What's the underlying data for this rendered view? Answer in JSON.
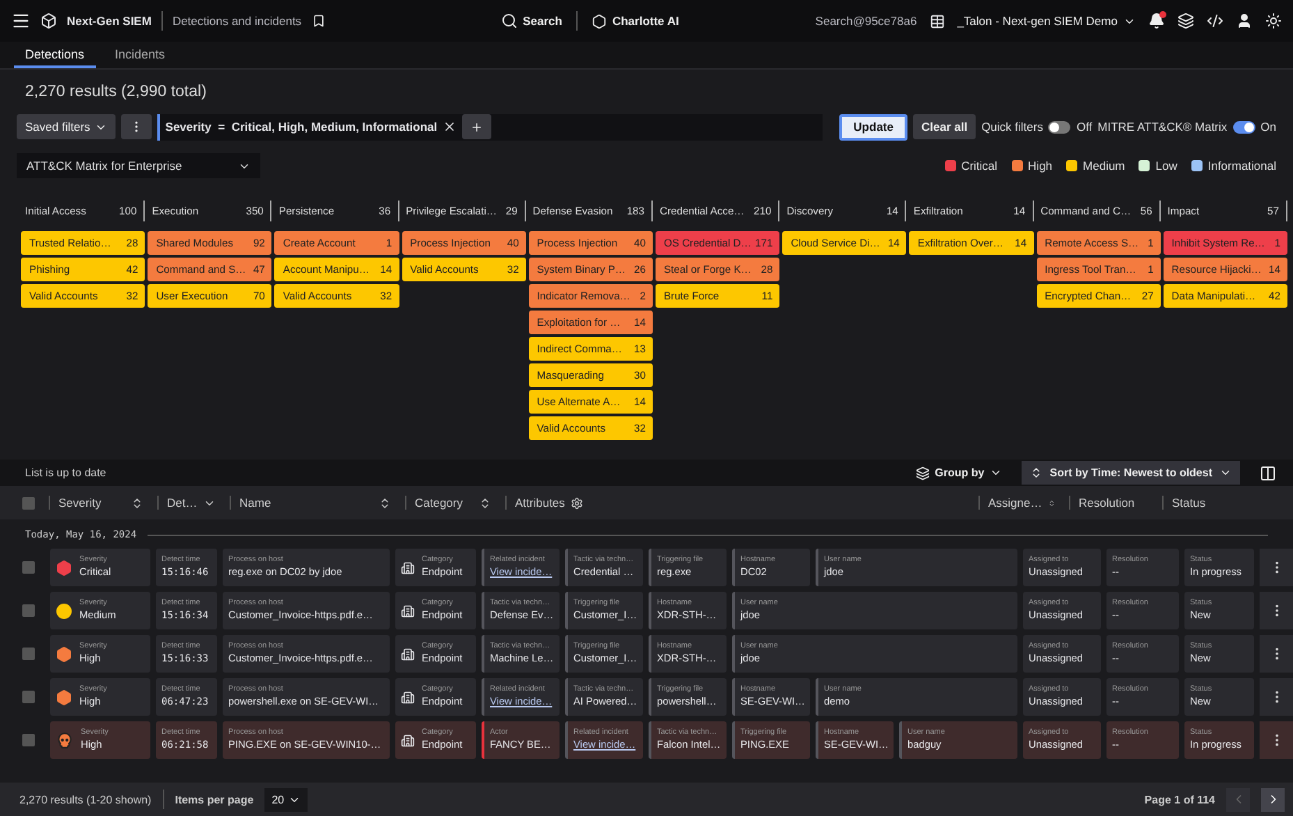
{
  "topbar": {
    "product": "Next-Gen SIEM",
    "page": "Detections and incidents",
    "search": "Search",
    "assistant": "Charlotte AI",
    "search_id": "Search@95ce78a6",
    "tenant": "_Talon - Next-gen SIEM Demo"
  },
  "tabs": [
    {
      "label": "Detections",
      "selected": true
    },
    {
      "label": "Incidents",
      "selected": false
    }
  ],
  "results": "2,270 results (2,990 total)",
  "filters": {
    "saved": "Saved filters",
    "chip_field": "Severity",
    "chip_op": "=",
    "chip_value": "Critical, High, Medium, Informational",
    "update": "Update",
    "clear": "Clear all",
    "toggles": [
      {
        "label": "Quick filters",
        "on": false,
        "state_label": "Off"
      },
      {
        "label": "MITRE ATT&CK® Matrix",
        "on": true,
        "state_label": "On"
      }
    ]
  },
  "matrix_select": "ATT&CK Matrix for Enterprise",
  "legend": [
    {
      "label": "Critical",
      "color": "#ee3f4a"
    },
    {
      "label": "High",
      "color": "#f47b3f"
    },
    {
      "label": "Medium",
      "color": "#fdc700"
    },
    {
      "label": "Low",
      "color": "#d6f2d6"
    },
    {
      "label": "Informational",
      "color": "#9cc3f5"
    }
  ],
  "matrix": [
    {
      "name": "Initial Access",
      "count": "100",
      "tiles": [
        {
          "label": "Trusted Relatio…",
          "count": "28",
          "color": "#fdc700"
        },
        {
          "label": "Phishing",
          "count": "42",
          "color": "#fdc700"
        },
        {
          "label": "Valid Accounts",
          "count": "32",
          "color": "#fdc700"
        }
      ]
    },
    {
      "name": "Execution",
      "count": "350",
      "tiles": [
        {
          "label": "Shared Modules",
          "count": "92",
          "color": "#f47b3f"
        },
        {
          "label": "Command and S…",
          "count": "47",
          "color": "#f47b3f"
        },
        {
          "label": "User Execution",
          "count": "70",
          "color": "#fdc700"
        }
      ]
    },
    {
      "name": "Persistence",
      "count": "36",
      "tiles": [
        {
          "label": "Create Account",
          "count": "1",
          "color": "#f47b3f"
        },
        {
          "label": "Account Manipu…",
          "count": "14",
          "color": "#fdc700"
        },
        {
          "label": "Valid Accounts",
          "count": "32",
          "color": "#fdc700"
        }
      ]
    },
    {
      "name": "Privilege Escalati…",
      "count": "29",
      "tiles": [
        {
          "label": "Process Injection",
          "count": "40",
          "color": "#f47b3f"
        },
        {
          "label": "Valid Accounts",
          "count": "32",
          "color": "#fdc700"
        }
      ]
    },
    {
      "name": "Defense Evasion",
      "count": "183",
      "tiles": [
        {
          "label": "Process Injection",
          "count": "40",
          "color": "#f47b3f"
        },
        {
          "label": "System Binary P…",
          "count": "26",
          "color": "#f47b3f"
        },
        {
          "label": "Indicator Remova…",
          "count": "2",
          "color": "#f47b3f"
        },
        {
          "label": "Exploitation for …",
          "count": "14",
          "color": "#f47b3f"
        },
        {
          "label": "Indirect Comma…",
          "count": "13",
          "color": "#fdc700"
        },
        {
          "label": "Masquerading",
          "count": "30",
          "color": "#fdc700"
        },
        {
          "label": "Use Alternate A…",
          "count": "14",
          "color": "#fdc700"
        },
        {
          "label": "Valid Accounts",
          "count": "32",
          "color": "#fdc700"
        }
      ]
    },
    {
      "name": "Credential Acce…",
      "count": "210",
      "tiles": [
        {
          "label": "OS Credential D…",
          "count": "171",
          "color": "#ee3f4a"
        },
        {
          "label": "Steal or Forge K…",
          "count": "28",
          "color": "#f47b3f"
        },
        {
          "label": "Brute Force",
          "count": "11",
          "color": "#fdc700"
        }
      ]
    },
    {
      "name": "Discovery",
      "count": "14",
      "tiles": [
        {
          "label": "Cloud Service Di…",
          "count": "14",
          "color": "#fdc700"
        }
      ]
    },
    {
      "name": "Exfiltration",
      "count": "14",
      "tiles": [
        {
          "label": "Exfiltration Over…",
          "count": "14",
          "color": "#fdc700"
        }
      ]
    },
    {
      "name": "Command and C…",
      "count": "56",
      "tiles": [
        {
          "label": "Remote Access S…",
          "count": "1",
          "color": "#f47b3f"
        },
        {
          "label": "Ingress Tool Tran…",
          "count": "1",
          "color": "#f47b3f"
        },
        {
          "label": "Encrypted Chan…",
          "count": "27",
          "color": "#fdc700"
        }
      ]
    },
    {
      "name": "Impact",
      "count": "57",
      "tiles": [
        {
          "label": "Inhibit System Re…",
          "count": "1",
          "color": "#ee3f4a"
        },
        {
          "label": "Resource Hijacki…",
          "count": "14",
          "color": "#f47b3f"
        },
        {
          "label": "Data Manipulati…",
          "count": "42",
          "color": "#fdc700"
        }
      ]
    }
  ],
  "list_status": "List is up to date",
  "group_by": "Group by",
  "sort_by": "Sort by Time: Newest to oldest",
  "select_all": {
    "checked": false
  },
  "columns": [
    "Severity",
    "Det…",
    "Name",
    "Category",
    "Attributes",
    "Assigne…",
    "Resolution",
    "Status"
  ],
  "date_group": "Today, May 16, 2024",
  "rows": [
    {
      "checked": false,
      "highlighted": false,
      "severity": {
        "label": "Severity",
        "value": "Critical",
        "kind": "hexagon",
        "color": "#ee3f4a"
      },
      "time": {
        "label": "Detect time",
        "value": "15:16:46"
      },
      "process": {
        "label": "Process on host",
        "value": "reg.exe on DC02 by jdoe"
      },
      "category": {
        "label": "Category",
        "value": "Endpoint"
      },
      "attributes": [
        {
          "label": "Related incident",
          "value": "View incide…",
          "kind": "link"
        },
        {
          "label": "Tactic via techn…",
          "value": "Credential …",
          "kind": "text"
        },
        {
          "label": "Triggering file",
          "value": "reg.exe",
          "kind": "text"
        },
        {
          "label": "Hostname",
          "value": "DC02",
          "kind": "text"
        },
        {
          "label": "User name",
          "value": "jdoe",
          "kind": "text"
        }
      ],
      "assigned": {
        "label": "Assigned to",
        "value": "Unassigned"
      },
      "resolution": {
        "label": "Resolution",
        "value": "--"
      },
      "status": {
        "label": "Status",
        "value": "In progress"
      }
    },
    {
      "checked": false,
      "highlighted": false,
      "severity": {
        "label": "Severity",
        "value": "Medium",
        "kind": "circle",
        "color": "#fdc700"
      },
      "time": {
        "label": "Detect time",
        "value": "15:16:34"
      },
      "process": {
        "label": "Process on host",
        "value": "Customer_Invoice-https.pdf.e…"
      },
      "category": {
        "label": "Category",
        "value": "Endpoint"
      },
      "attributes": [
        {
          "label": "Tactic via techn…",
          "value": "Defense Ev…",
          "kind": "text"
        },
        {
          "label": "Triggering file",
          "value": "Customer_I…",
          "kind": "text"
        },
        {
          "label": "Hostname",
          "value": "XDR-STH-…",
          "kind": "text"
        },
        {
          "label": "User name",
          "value": "jdoe",
          "kind": "text"
        }
      ],
      "assigned": {
        "label": "Assigned to",
        "value": "Unassigned"
      },
      "resolution": {
        "label": "Resolution",
        "value": "--"
      },
      "status": {
        "label": "Status",
        "value": "New"
      }
    },
    {
      "checked": false,
      "highlighted": false,
      "severity": {
        "label": "Severity",
        "value": "High",
        "kind": "hexagon",
        "color": "#f47b3f"
      },
      "time": {
        "label": "Detect time",
        "value": "15:16:33"
      },
      "process": {
        "label": "Process on host",
        "value": "Customer_Invoice-https.pdf.e…"
      },
      "category": {
        "label": "Category",
        "value": "Endpoint"
      },
      "attributes": [
        {
          "label": "Tactic via techn…",
          "value": "Machine Le…",
          "kind": "text"
        },
        {
          "label": "Triggering file",
          "value": "Customer_I…",
          "kind": "text"
        },
        {
          "label": "Hostname",
          "value": "XDR-STH-…",
          "kind": "text"
        },
        {
          "label": "User name",
          "value": "jdoe",
          "kind": "text"
        }
      ],
      "assigned": {
        "label": "Assigned to",
        "value": "Unassigned"
      },
      "resolution": {
        "label": "Resolution",
        "value": "--"
      },
      "status": {
        "label": "Status",
        "value": "New"
      }
    },
    {
      "checked": false,
      "highlighted": false,
      "severity": {
        "label": "Severity",
        "value": "High",
        "kind": "hexagon",
        "color": "#f47b3f"
      },
      "time": {
        "label": "Detect time",
        "value": "06:47:23"
      },
      "process": {
        "label": "Process on host",
        "value": "powershell.exe on SE-GEV-WI…"
      },
      "category": {
        "label": "Category",
        "value": "Endpoint"
      },
      "attributes": [
        {
          "label": "Related incident",
          "value": "View incide…",
          "kind": "link"
        },
        {
          "label": "Tactic via techn…",
          "value": "AI Powered…",
          "kind": "text"
        },
        {
          "label": "Triggering file",
          "value": "powershell…",
          "kind": "text"
        },
        {
          "label": "Hostname",
          "value": "SE-GEV-WI…",
          "kind": "text"
        },
        {
          "label": "User name",
          "value": "demo",
          "kind": "text"
        }
      ],
      "assigned": {
        "label": "Assigned to",
        "value": "Unassigned"
      },
      "resolution": {
        "label": "Resolution",
        "value": "--"
      },
      "status": {
        "label": "Status",
        "value": "New"
      }
    },
    {
      "checked": false,
      "highlighted": true,
      "severity": {
        "label": "Severity",
        "value": "High",
        "kind": "skull",
        "color": "#f47b3f"
      },
      "time": {
        "label": "Detect time",
        "value": "06:21:58"
      },
      "process": {
        "label": "Process on host",
        "value": "PING.EXE on SE-GEV-WIN10-…"
      },
      "category": {
        "label": "Category",
        "value": "Endpoint"
      },
      "attributes": [
        {
          "label": "Actor",
          "value": "FANCY BE…",
          "kind": "actor"
        },
        {
          "label": "Related incident",
          "value": "View incide…",
          "kind": "link"
        },
        {
          "label": "Tactic via techn…",
          "value": "Falcon Intel…",
          "kind": "text"
        },
        {
          "label": "Triggering file",
          "value": "PING.EXE",
          "kind": "text"
        },
        {
          "label": "Hostname",
          "value": "SE-GEV-WI…",
          "kind": "text"
        },
        {
          "label": "User name",
          "value": "badguy",
          "kind": "text"
        }
      ],
      "assigned": {
        "label": "Assigned to",
        "value": "Unassigned"
      },
      "resolution": {
        "label": "Resolution",
        "value": "--"
      },
      "status": {
        "label": "Status",
        "value": "In progress"
      }
    }
  ],
  "footer": {
    "results": "2,270 results (1-20 shown)",
    "per_page_label": "Items per page",
    "per_page": "20",
    "page": "Page 1 of 114"
  }
}
